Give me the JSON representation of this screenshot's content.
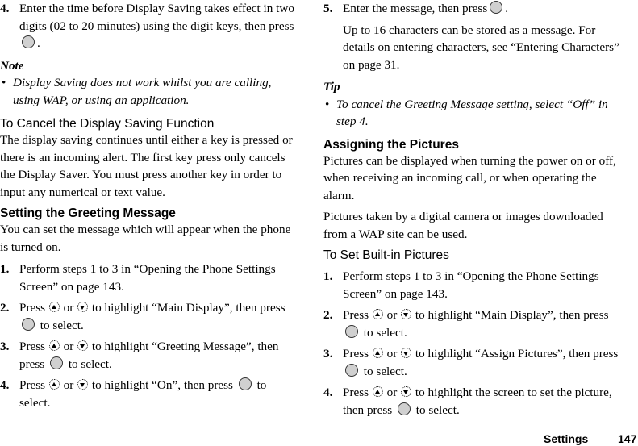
{
  "left_column": {
    "step4_display_saving": {
      "num": "4.",
      "text_before": "Enter the time before Display Saving takes effect in two digits (02 to 20 minutes) using the digit keys, then press",
      "text_after": "."
    },
    "note": {
      "label": "Note",
      "bullet": "Display Saving does not work whilst you are calling, using WAP, or using an application."
    },
    "cancel_heading": "To Cancel the Display Saving Function",
    "cancel_body": "The display saving continues until either a key is pressed or there is an incoming alert. The first key press only cancels the Display Saver. You must press another key in order to input any numerical or text value.",
    "greeting_heading": "Setting the Greeting Message",
    "greeting_body": "You can set the message which will appear when the phone is turned on.",
    "steps": [
      {
        "num": "1.",
        "text": "Perform steps 1 to 3 in “Opening the Phone Settings Screen” on page 143."
      },
      {
        "num": "2.",
        "press": "Press",
        "or": "or",
        "mid": "to highlight “Main Display”, then press",
        "end": "to select."
      },
      {
        "num": "3.",
        "press": "Press",
        "or": "or",
        "mid": "to highlight “Greeting Message”, then press",
        "end": "to select."
      },
      {
        "num": "4.",
        "press": "Press",
        "or": "or",
        "mid": "to highlight “On”, then press",
        "end": "to select."
      }
    ]
  },
  "right_column": {
    "step5": {
      "num": "5.",
      "text_before": "Enter the message, then press",
      "text_after": ".",
      "detail": "Up to 16 characters can be stored as a message. For details on entering characters, see “Entering Characters” on page 31."
    },
    "tip": {
      "label": "Tip",
      "bullet": "To cancel the Greeting Message setting, select “Off” in step 4."
    },
    "pictures_heading": "Assigning the Pictures",
    "pictures_body1": "Pictures can be displayed when turning the power on or off, when receiving an incoming call, or when operating the alarm.",
    "pictures_body2": "Pictures taken by a digital camera or images downloaded from a WAP site can be used.",
    "builtin_heading": "To Set Built-in Pictures",
    "steps": [
      {
        "num": "1.",
        "text": "Perform steps 1 to 3 in “Opening the Phone Settings Screen” on page 143."
      },
      {
        "num": "2.",
        "press": "Press",
        "or": "or",
        "mid": "to highlight “Main Display”, then press",
        "end": "to select."
      },
      {
        "num": "3.",
        "press": "Press",
        "or": "or",
        "mid": "to highlight “Assign Pictures”, then press",
        "end": "to select."
      },
      {
        "num": "4.",
        "press": "Press",
        "or": "or",
        "mid": "to highlight the screen to set the picture, then press",
        "end": "to select."
      }
    ]
  },
  "footer": {
    "section": "Settings",
    "page_number": "147"
  }
}
